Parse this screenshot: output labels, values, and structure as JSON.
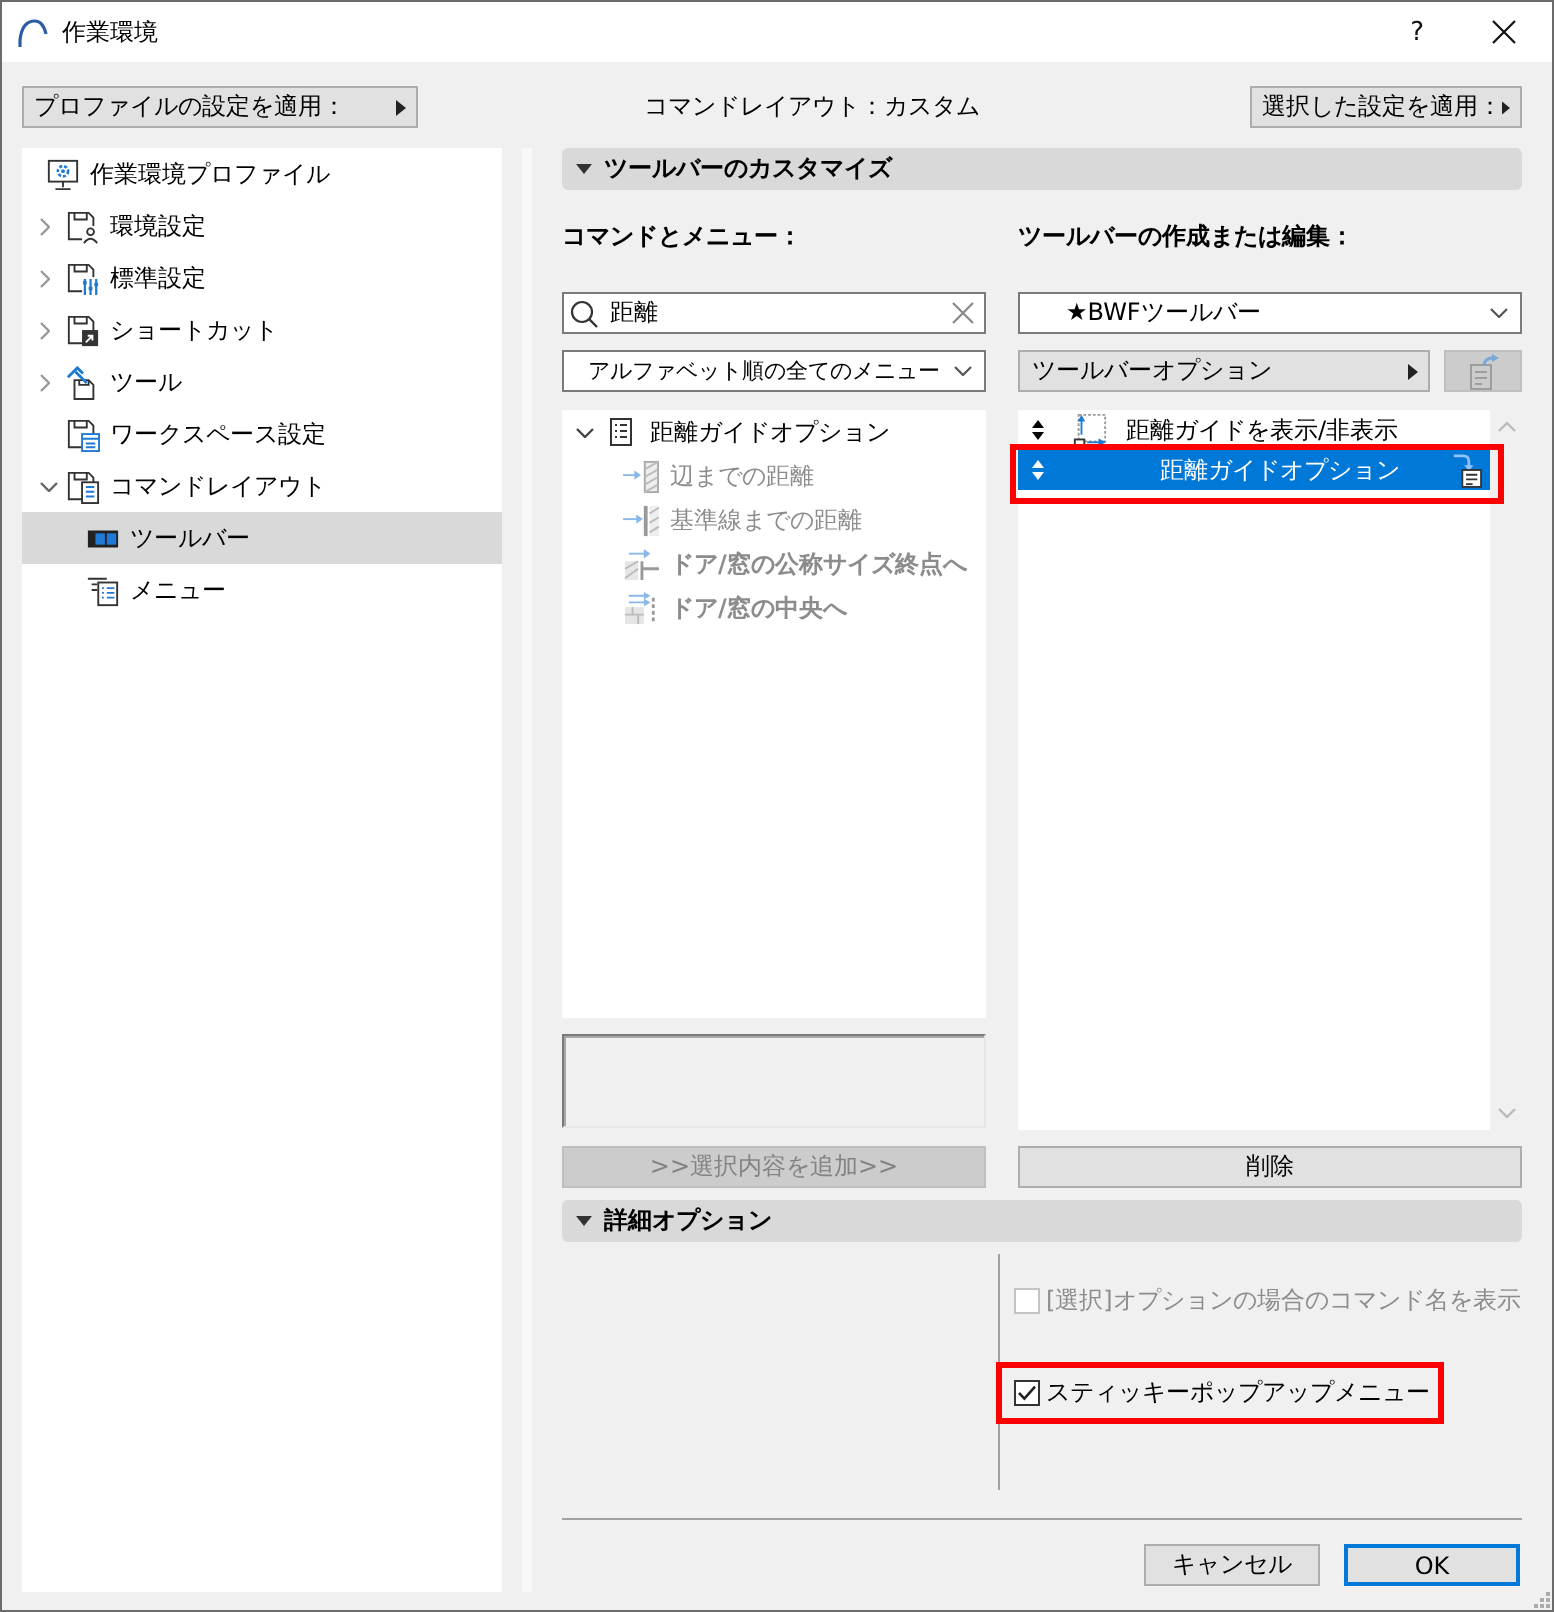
{
  "window": {
    "title": "作業環境",
    "help_label": "?"
  },
  "top_bar": {
    "apply_profile_button": {
      "label": "プロファイルの設定を適用："
    },
    "layout_status": "コマンドレイアウト：カスタム",
    "apply_selected_button": {
      "label": "選択した設定を適用："
    }
  },
  "sidebar": {
    "items": [
      {
        "label": "作業環境プロファイル",
        "kind": "profile",
        "selected": false
      },
      {
        "label": "環境設定",
        "kind": "environment",
        "expanded": false,
        "selected": false
      },
      {
        "label": "標準設定",
        "kind": "standards",
        "expanded": false,
        "selected": false
      },
      {
        "label": "ショートカット",
        "kind": "shortcuts",
        "expanded": false,
        "selected": false
      },
      {
        "label": "ツール",
        "kind": "tools",
        "expanded": false,
        "selected": false
      },
      {
        "label": "ワークスペース設定",
        "kind": "workspace",
        "selected": false
      },
      {
        "label": "コマンドレイアウト",
        "kind": "layout",
        "expanded": true,
        "selected": false,
        "children": [
          {
            "label": "ツールバー",
            "kind": "toolbar",
            "selected": true
          },
          {
            "label": "メニュー",
            "kind": "menu",
            "selected": false
          }
        ]
      }
    ]
  },
  "customize": {
    "title": "ツールバーのカスタマイズ",
    "expanded": true
  },
  "commands": {
    "label": "コマンドとメニュー：",
    "search": {
      "value": "距離"
    },
    "filter": {
      "value": "アルファベット順の全てのメニュー"
    },
    "tree": [
      {
        "label": "距離ガイドオプション",
        "kind": "group",
        "expanded": true,
        "disabled": false,
        "bold": false,
        "children": [
          {
            "label": "辺までの距離",
            "kind": "edge",
            "disabled": true,
            "bold": false
          },
          {
            "label": "基準線までの距離",
            "kind": "baseline",
            "disabled": true,
            "bold": false
          },
          {
            "label": "ドア/窓の公称サイズ終点へ",
            "kind": "nominal",
            "disabled": true,
            "bold": true
          },
          {
            "label": "ドア/窓の中央へ",
            "kind": "center",
            "disabled": true,
            "bold": true
          }
        ]
      }
    ],
    "add_button": {
      "label": ">>選択内容を追加>>",
      "disabled": true
    }
  },
  "editor": {
    "label": "ツールバーの作成または編集：",
    "toolbar_select": {
      "value": "★BWFツールバー"
    },
    "options_button": {
      "label": "ツールバーオプション"
    },
    "export_button": {
      "disabled": true
    },
    "items": [
      {
        "label": "距離ガイドを表示/非表示",
        "kind": "command",
        "selected": false,
        "highlighted": false
      },
      {
        "label": "距離ガイドオプション",
        "kind": "menu",
        "selected": true,
        "highlighted": true
      }
    ],
    "delete_button": {
      "label": "削除"
    }
  },
  "advanced": {
    "title": "詳細オプション",
    "expanded": true,
    "options": [
      {
        "label": "[選択]オプションの場合のコマンド名を表示",
        "checked": false,
        "disabled": true,
        "highlighted": false
      },
      {
        "label": "スティッキーポップアップメニュー",
        "checked": true,
        "disabled": false,
        "highlighted": true
      }
    ]
  },
  "footer": {
    "buttons": [
      {
        "label": "キャンセル",
        "default": false
      },
      {
        "label": "OK",
        "default": true
      }
    ]
  }
}
